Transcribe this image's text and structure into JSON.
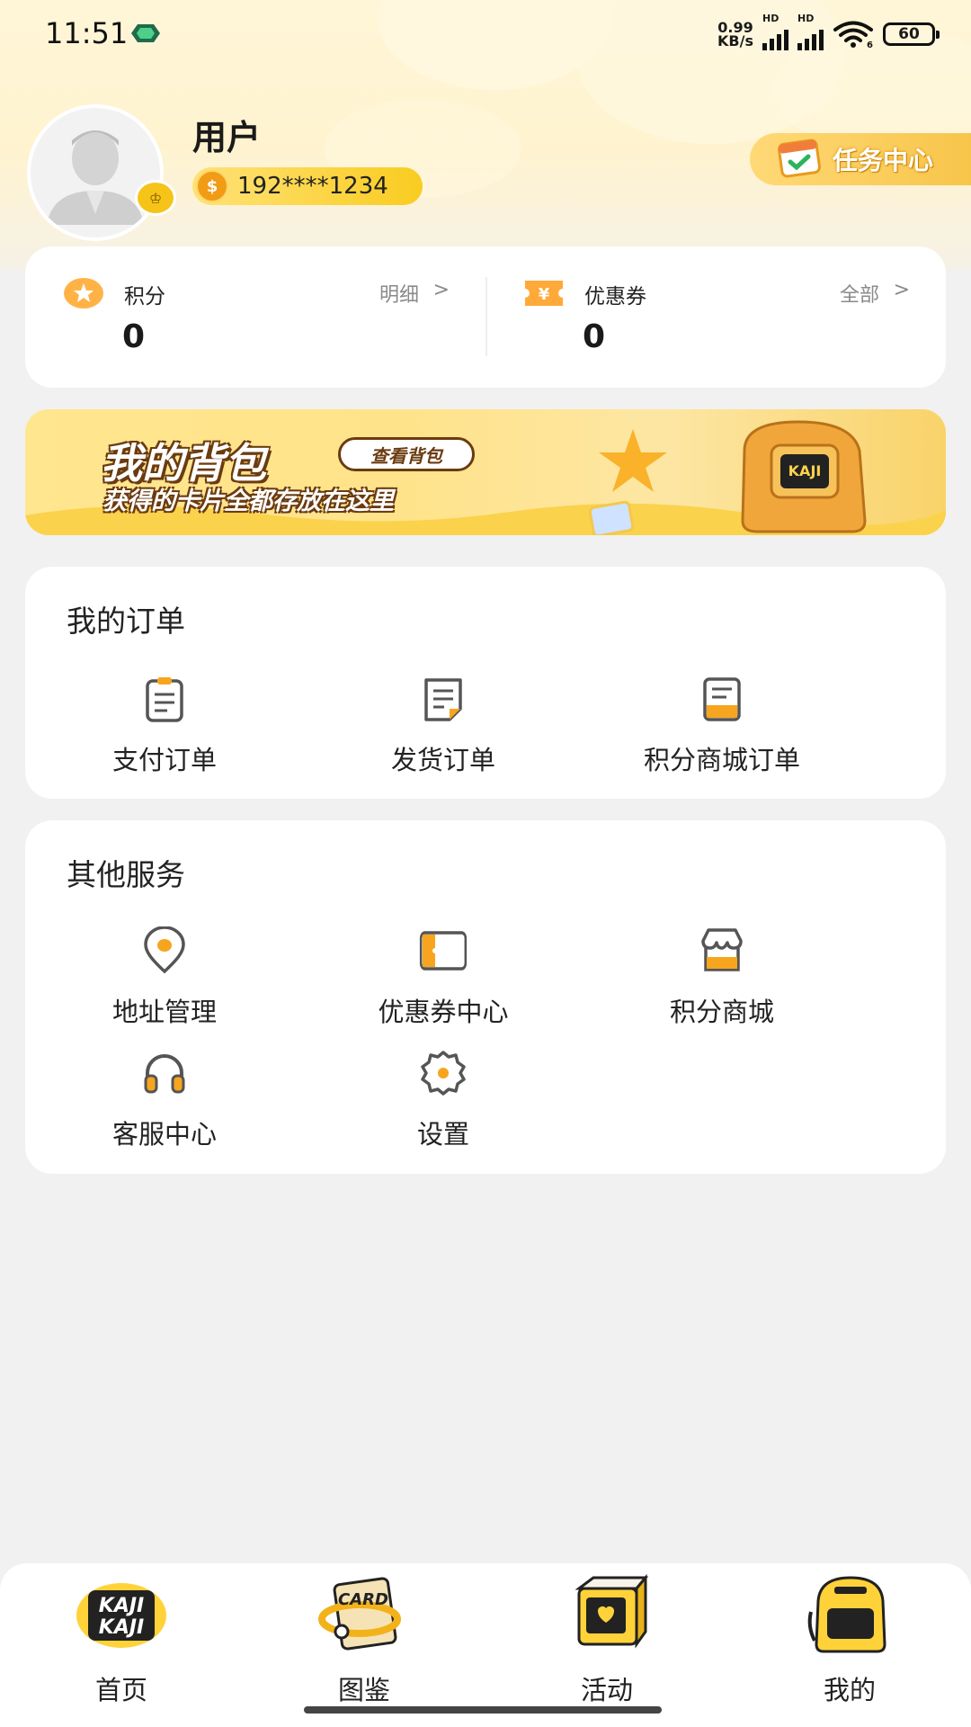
{
  "status_bar": {
    "time": "11:51",
    "net_speed_value": "0.99",
    "net_speed_unit": "KB/s",
    "hd1": "HD",
    "hd2": "HD",
    "wifi_gen": "6",
    "battery": "60"
  },
  "profile": {
    "name": "用户",
    "phone": "192****1234",
    "task_center": "任务中心"
  },
  "points": {
    "points_label": "积分",
    "points_value": "0",
    "points_link": "明细",
    "coupons_label": "优惠券",
    "coupons_value": "0",
    "coupons_link": "全部",
    "chevron": ">",
    "coupon_symbol": "¥"
  },
  "banner": {
    "title": "我的背包",
    "button": "查看背包",
    "subtitle": "获得的卡片全都存放在这里"
  },
  "orders": {
    "title": "我的订单",
    "items": [
      {
        "label": "支付订单",
        "icon": "clipboard-icon"
      },
      {
        "label": "发货订单",
        "icon": "document-icon"
      },
      {
        "label": "积分商城订单",
        "icon": "receipt-icon"
      }
    ]
  },
  "services": {
    "title": "其他服务",
    "items": [
      {
        "label": "地址管理",
        "icon": "location-pin-icon"
      },
      {
        "label": "优惠券中心",
        "icon": "ticket-icon"
      },
      {
        "label": "积分商城",
        "icon": "store-icon"
      },
      {
        "label": "客服中心",
        "icon": "headset-icon"
      },
      {
        "label": "设置",
        "icon": "gear-icon"
      }
    ]
  },
  "tabbar": {
    "items": [
      {
        "label": "首页",
        "icon": "kaji-logo-icon"
      },
      {
        "label": "图鉴",
        "icon": "card-icon",
        "icon_text": "CARD"
      },
      {
        "label": "活动",
        "icon": "tv-box-icon"
      },
      {
        "label": "我的",
        "icon": "backpack-icon"
      }
    ]
  },
  "colors": {
    "accent": "#F7C01A",
    "orange": "#F29B15",
    "brown": "#6B3B10",
    "page_bg": "#F1F1F1"
  }
}
